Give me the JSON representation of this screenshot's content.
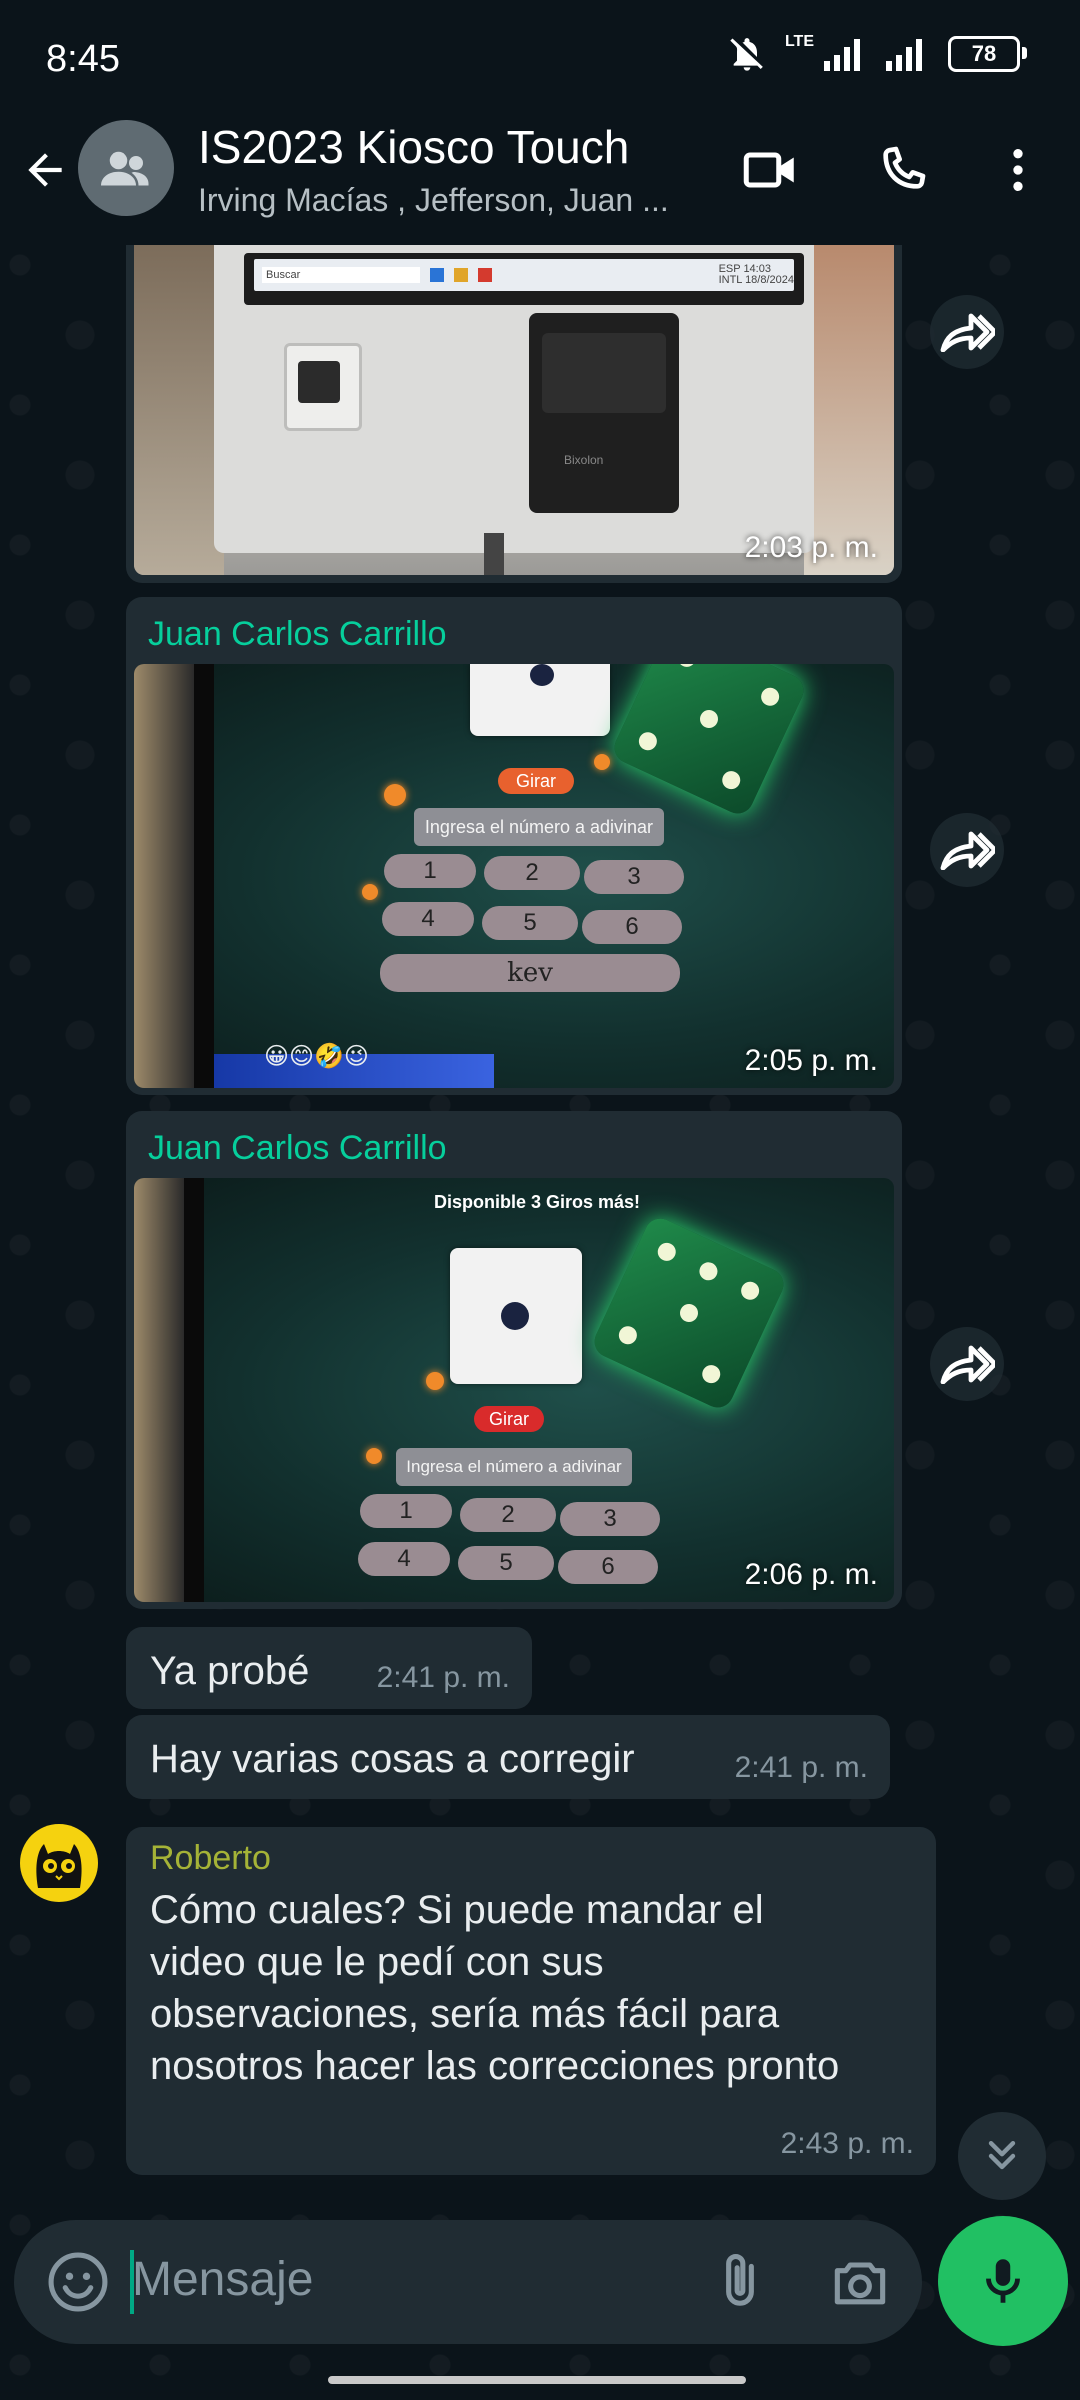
{
  "status_bar": {
    "time": "8:45",
    "network": "LTE",
    "battery": "78"
  },
  "header": {
    "title": "IS2023 Kiosco Touch",
    "subtitle": "Irving Macías , Jefferson, Juan ...",
    "icons": [
      "back-arrow-icon",
      "group-avatar-icon",
      "video-call-icon",
      "phone-icon",
      "more-vert-icon"
    ]
  },
  "messages": [
    {
      "type": "image",
      "sender": "",
      "time": "2:03 p. m.",
      "photo_text": [
        "ESP",
        "14:03",
        "INTL",
        "18/8/2024",
        "Buscar",
        "Bixolon"
      ]
    },
    {
      "type": "image",
      "sender": "Juan Carlos Carrillo",
      "sender_color": "#06cf9c",
      "time": "2:05 p. m.",
      "photo_text": [
        "Girar",
        "Ingresa el número a adivinar",
        "1",
        "2",
        "3",
        "4",
        "5",
        "6",
        "kev"
      ]
    },
    {
      "type": "image",
      "sender": "Juan Carlos Carrillo",
      "sender_color": "#06cf9c",
      "time": "2:06 p. m.",
      "photo_text": [
        "Disponible 3 Giros más!",
        "Girar",
        "Ingresa el número a adivinar",
        "1",
        "2",
        "3",
        "4",
        "5",
        "6"
      ]
    },
    {
      "type": "text",
      "text": "Ya probé",
      "time": "2:41 p. m."
    },
    {
      "type": "text",
      "text": "Hay varias cosas a corregir",
      "time": "2:41 p. m."
    },
    {
      "type": "text",
      "sender": "Roberto",
      "sender_color": "#a5b337",
      "text": "Cómo cuales? Si puede mandar el video que le pedí con sus observaciones, sería más fácil para nosotros hacer las correcciones pronto",
      "time": "2:43 p. m."
    }
  ],
  "composer": {
    "placeholder": "Mensaje"
  },
  "colors": {
    "background": "#0b141a",
    "bubble": "#202c33",
    "accent_green": "#21c063"
  }
}
